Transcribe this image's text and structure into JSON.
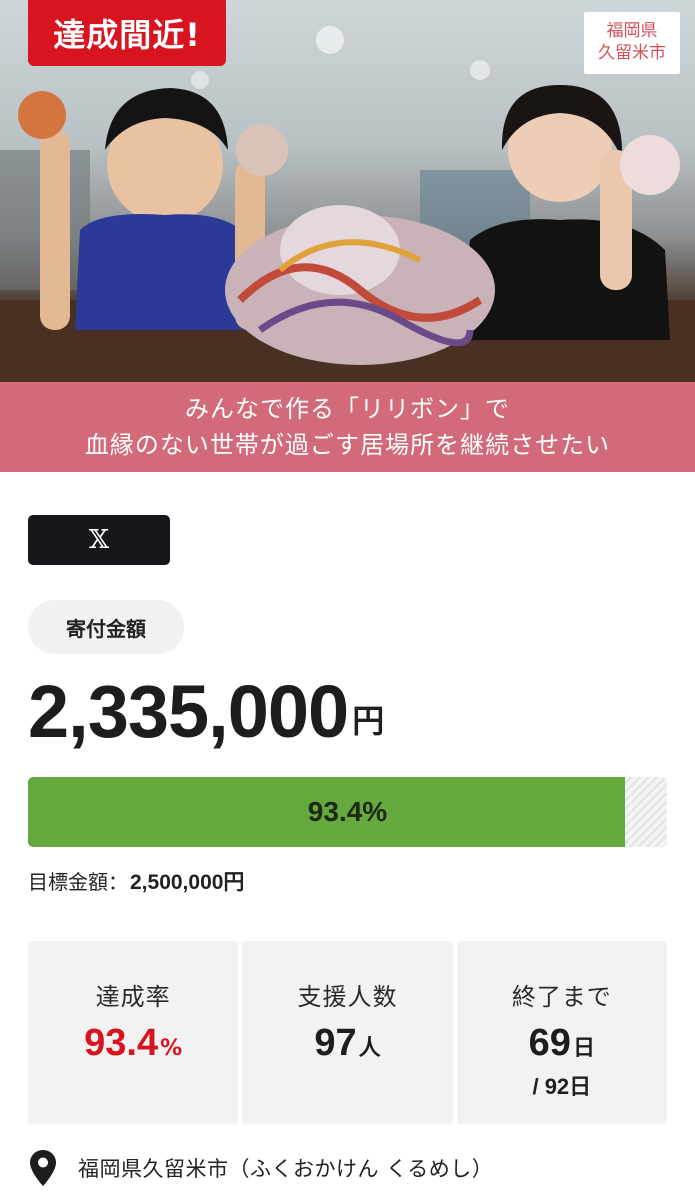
{
  "hero": {
    "badge_label": "達成間近!",
    "city_badge": [
      "福岡県",
      "久留米市"
    ],
    "caption_lines": [
      "みんなで作る「リリボン」で",
      "血縁のない世帯が過ごす居場所を継続させたい"
    ]
  },
  "share": {
    "x_label": "𝕏"
  },
  "donation": {
    "label": "寄付金額",
    "amount": "2,335,000",
    "unit": "円",
    "progress_text": "93.4%",
    "progress_fraction": 0.934,
    "goal_label": "目標金額：",
    "goal_value": "2,500,000円"
  },
  "stats": {
    "rate": {
      "label": "達成率",
      "value": "93.4",
      "unit": "%"
    },
    "supporters": {
      "label": "支援人数",
      "value": "97",
      "unit": "人"
    },
    "remaining": {
      "label": "終了まで",
      "value": "69",
      "unit": "日",
      "total": "/ 92日"
    }
  },
  "location": {
    "text": "福岡県久留米市（ふくおかけん くるめし）"
  },
  "colors": {
    "accent_red": "#d7141f",
    "caption_pink": "#d26a7a",
    "progress_green": "#66a93f"
  },
  "icons": [
    "x-logo-icon",
    "location-pin-icon"
  ]
}
